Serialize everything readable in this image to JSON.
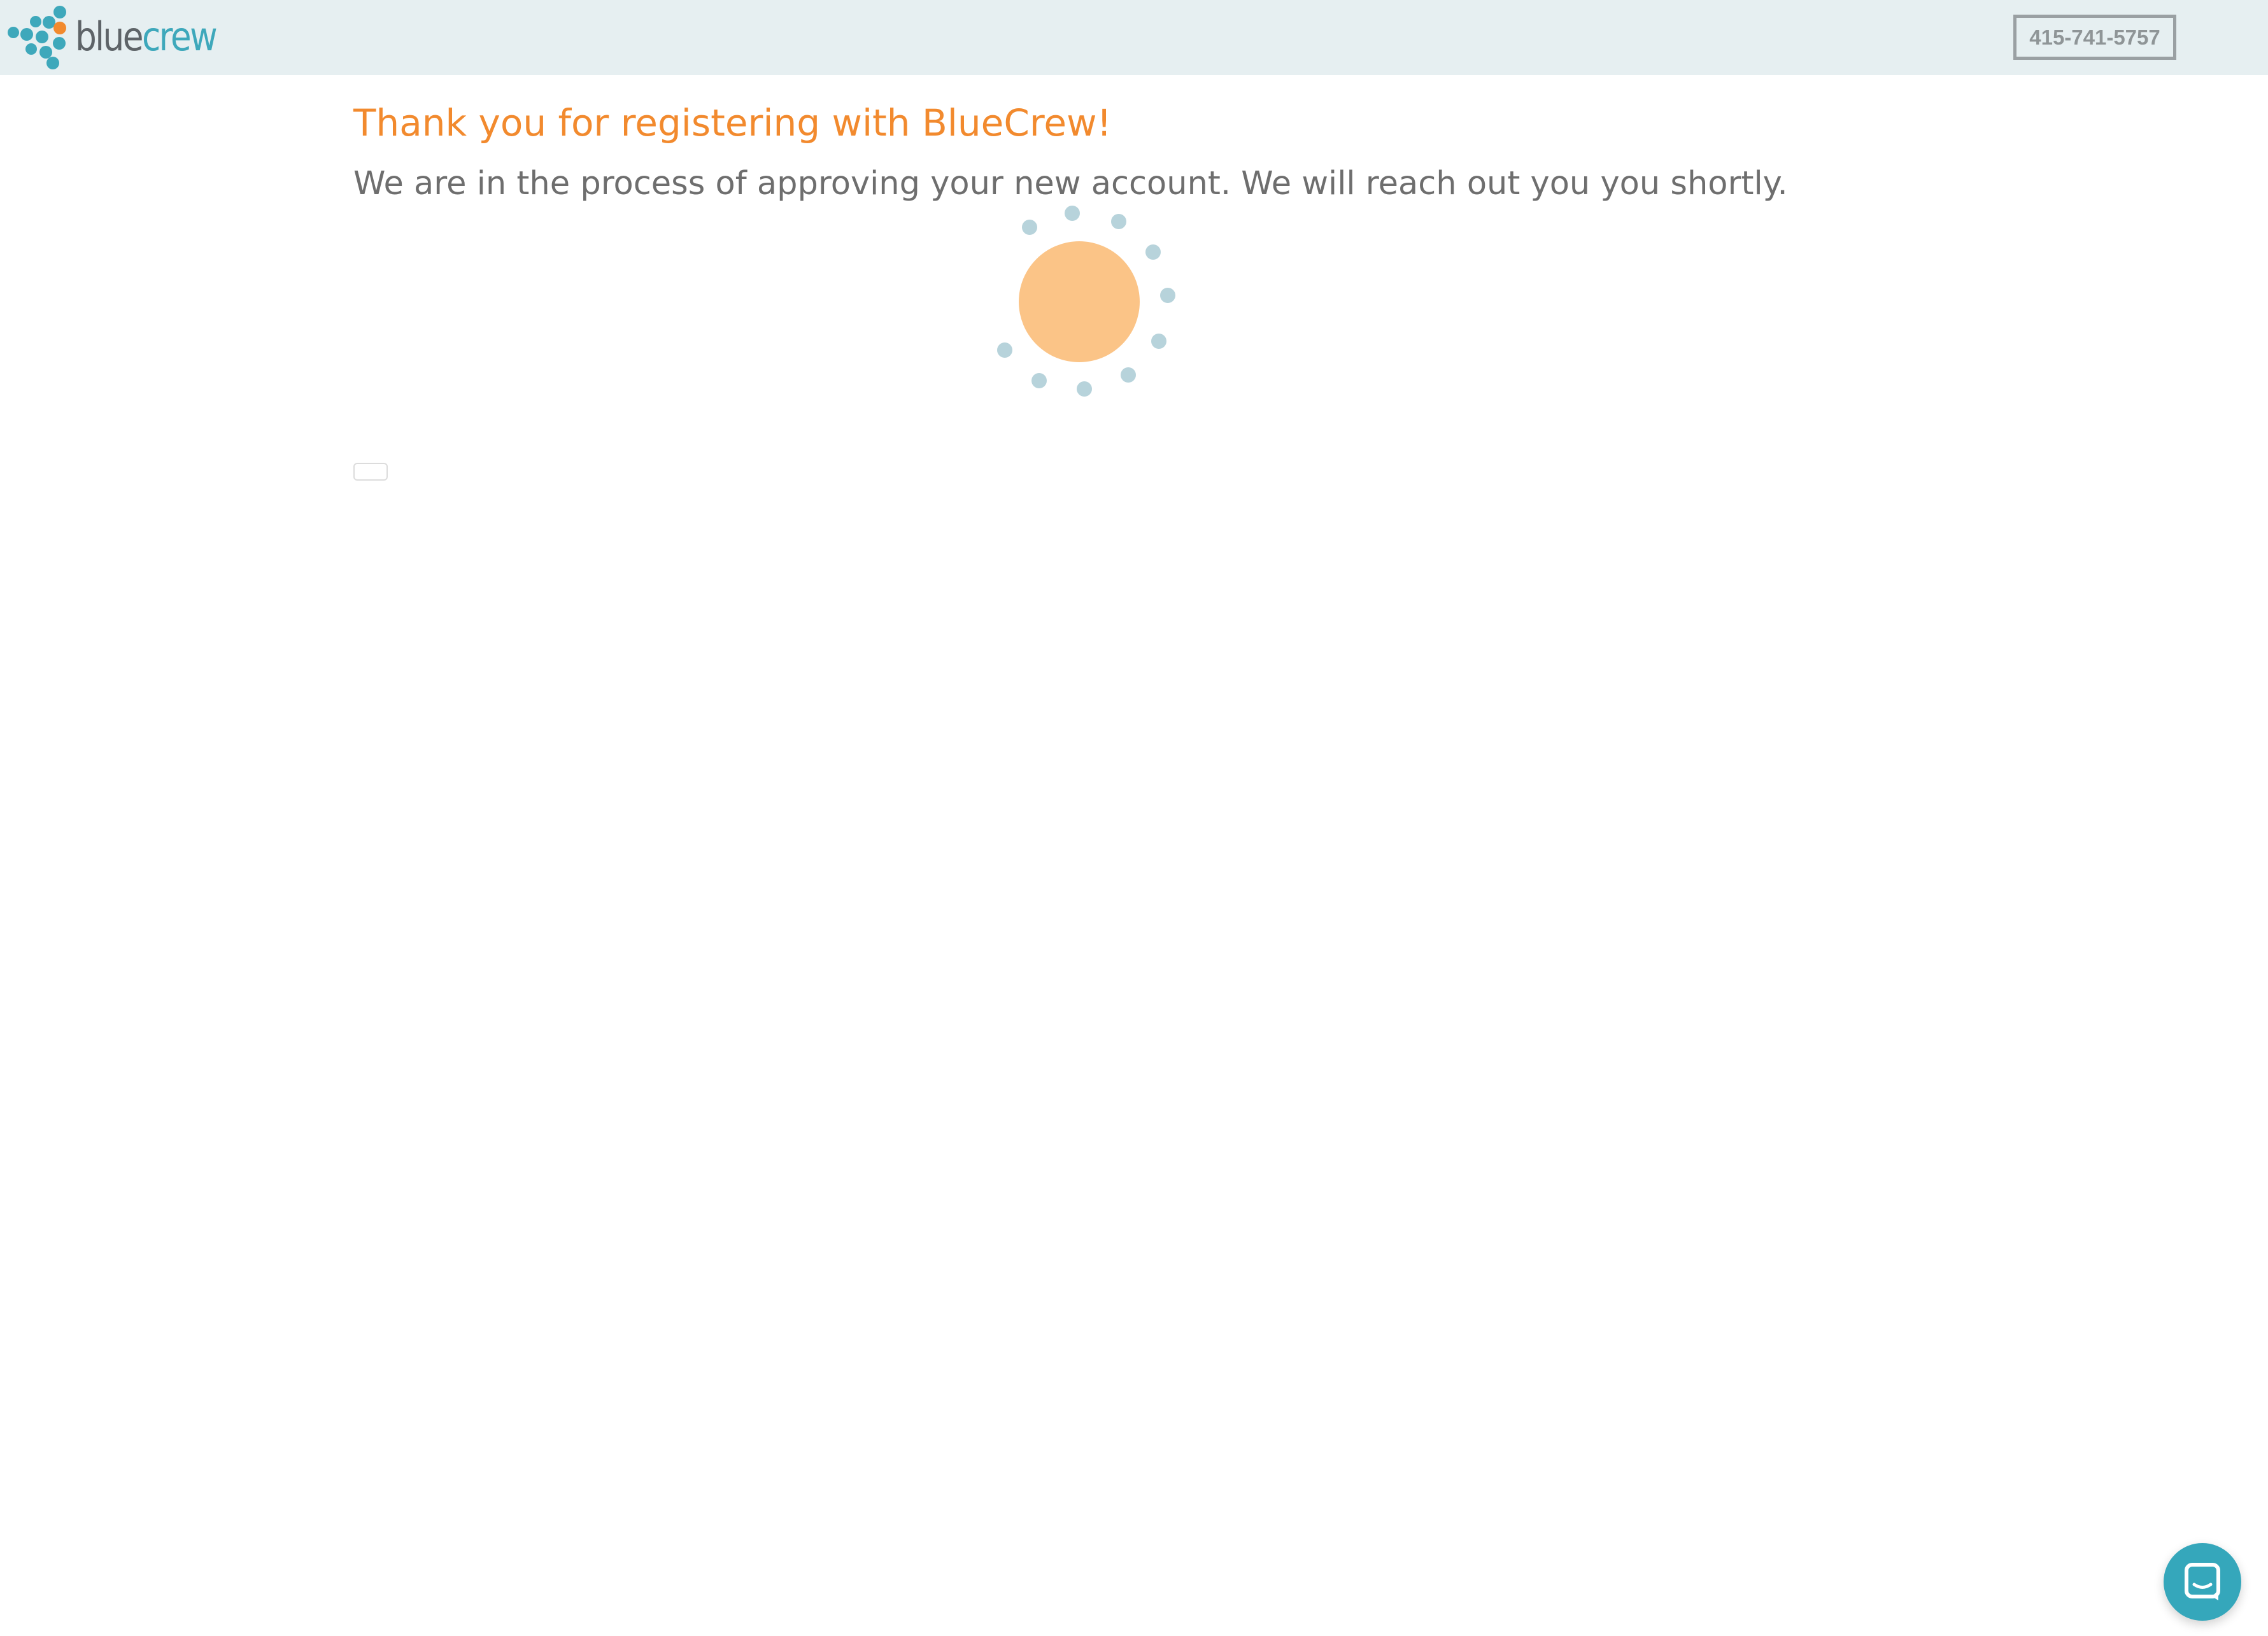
{
  "header": {
    "logo": {
      "word1": "blue",
      "word2": "crew",
      "icon": "bluecrew-dots-logo-icon"
    },
    "phone": "415-741-5757"
  },
  "main": {
    "title": "Thank you for registering with BlueCrew!",
    "message": "We are in the process of approving your new account. We will reach out you you shortly.",
    "loader": "loading-spinner-icon"
  },
  "chat": {
    "icon": "chat-icon"
  },
  "colors": {
    "header_bg": "#e6eff1",
    "brand_teal": "#3ea8bb",
    "brand_gray": "#5e6468",
    "accent_orange": "#f28a2e",
    "body_text": "#6e6e6e",
    "spinner_dot": "#b7d3db",
    "spinner_core": "#fbc487"
  }
}
